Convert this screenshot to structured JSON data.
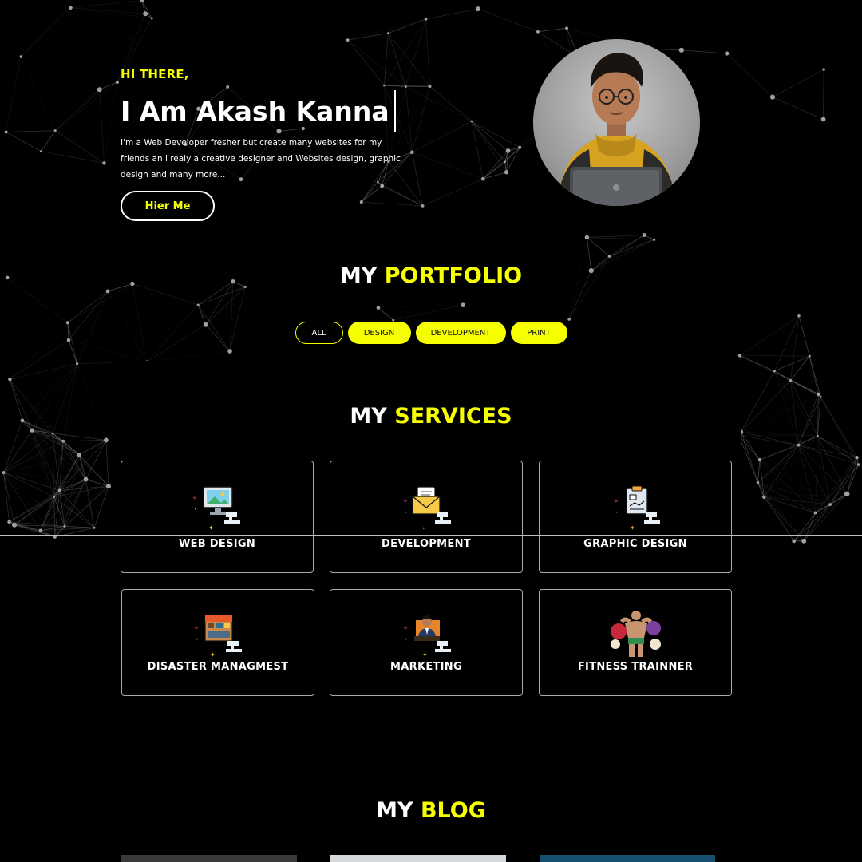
{
  "colors": {
    "accent": "#f6ff00",
    "background": "#000000",
    "network": "#8a8a8a",
    "text": "#ffffff"
  },
  "hero": {
    "greeting": "HI THERE,",
    "name": "I Am Akash Kanna",
    "intro": "I'm a Web Developer fresher but create many websites for my friends an i realy a creative designer and Websites design, graphic design and many more...",
    "cta_label": "Hier Me",
    "avatar_icon": "person-with-laptop-avatar"
  },
  "portfolio": {
    "title_prefix": "MY",
    "title_accent": "PORTFOLIO",
    "filters": [
      {
        "label": "ALL",
        "style": "outline"
      },
      {
        "label": "DESIGN",
        "style": "solid"
      },
      {
        "label": "DEVELOPMENT",
        "style": "solid"
      },
      {
        "label": "PRINT",
        "style": "solid"
      }
    ]
  },
  "services": {
    "title_prefix": "MY",
    "title_accent": "SERVICES",
    "items": [
      {
        "label": "WEB DESIGN",
        "icon": "monitor-landscape-icon"
      },
      {
        "label": "DEVELOPMENT",
        "icon": "envelope-letter-icon"
      },
      {
        "label": "GRAPHIC DESIGN",
        "icon": "clipboard-chart-icon"
      },
      {
        "label": "DISASTER MANAGMEST",
        "icon": "disaster-scene-icon"
      },
      {
        "label": "MARKETING",
        "icon": "businessman-icon"
      },
      {
        "label": "FITNESS TRAINNER",
        "icon": "bodybuilder-icon"
      }
    ]
  },
  "blog": {
    "title_prefix": "MY",
    "title_accent": "BLOG",
    "thumb_colors": [
      "#3a3a3a",
      "#d4d8da",
      "#17506e"
    ]
  }
}
